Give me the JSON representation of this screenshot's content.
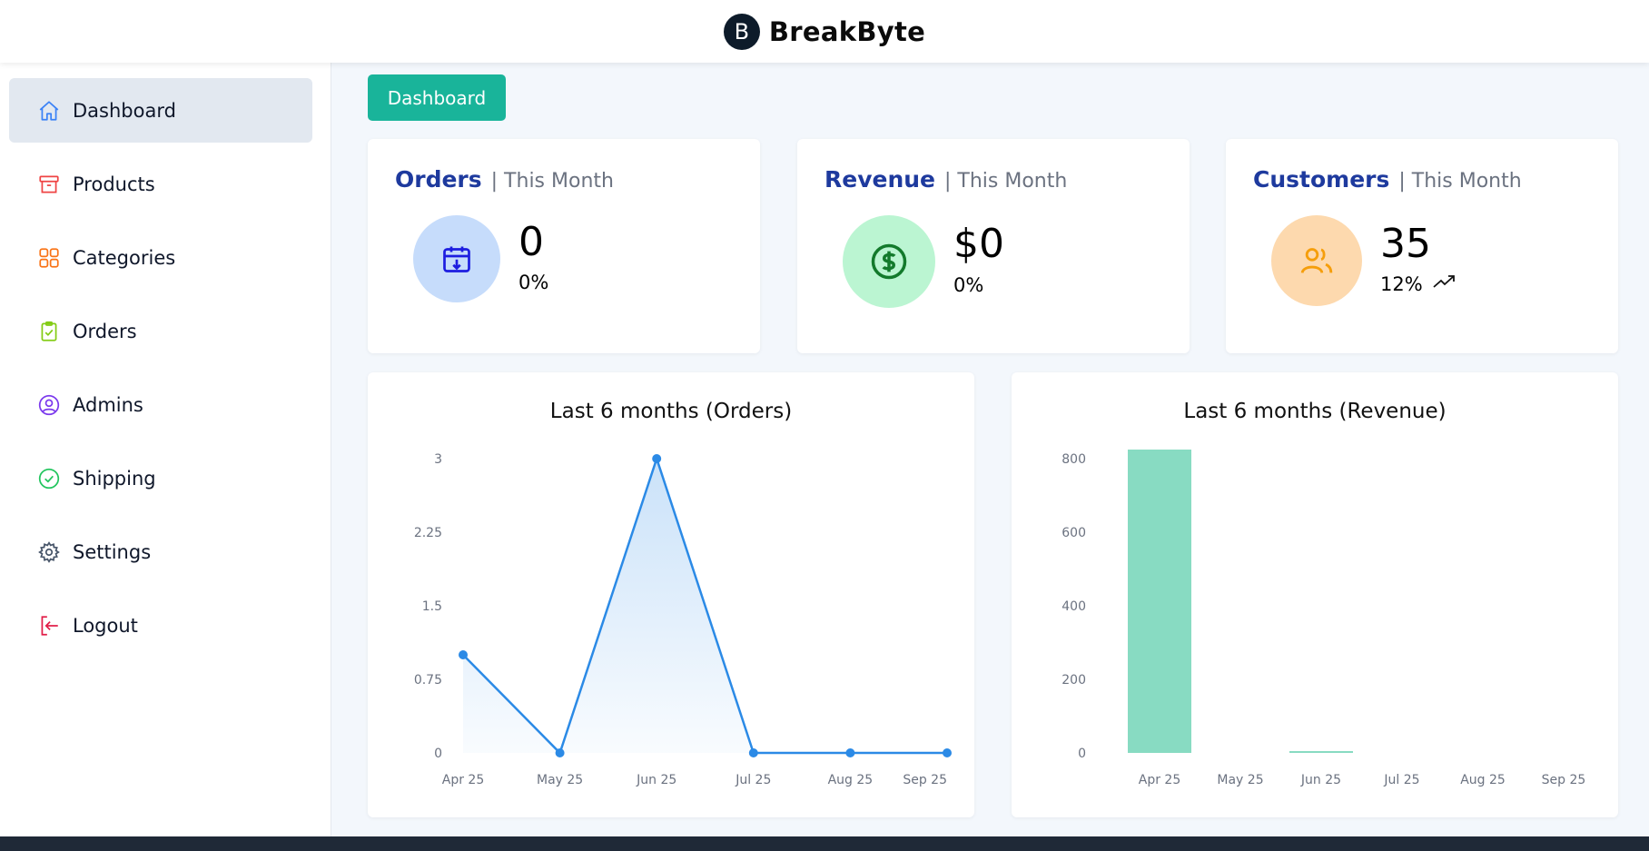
{
  "brand": {
    "logo_letter": "B",
    "name": "BreakByte"
  },
  "sidebar": {
    "items": [
      {
        "label": "Dashboard",
        "icon": "home-icon",
        "color": "#3b82f6",
        "active": true
      },
      {
        "label": "Products",
        "icon": "archive-icon",
        "color": "#ef4444"
      },
      {
        "label": "Categories",
        "icon": "grid-icon",
        "color": "#f97316"
      },
      {
        "label": "Orders",
        "icon": "clipboard-check-icon",
        "color": "#84cc16"
      },
      {
        "label": "Admins",
        "icon": "user-circle-icon",
        "color": "#7c3aed"
      },
      {
        "label": "Shipping",
        "icon": "check-circle-icon",
        "color": "#22c55e"
      },
      {
        "label": "Settings",
        "icon": "gear-icon",
        "color": "#475569"
      },
      {
        "label": "Logout",
        "icon": "logout-icon",
        "color": "#e11d48"
      }
    ]
  },
  "breadcrumb": {
    "label": "Dashboard"
  },
  "cards": [
    {
      "title": "Orders",
      "subtitle": "| This Month",
      "value": "0",
      "percent": "0%",
      "icon": "calendar-download-icon",
      "circle_color": "#c6dcfb",
      "icon_color": "#1d1de0"
    },
    {
      "title": "Revenue",
      "subtitle": "| This Month",
      "value": "$0",
      "percent": "0%",
      "icon": "dollar-icon",
      "circle_color": "#bbf5d2",
      "icon_color": "#137a2c"
    },
    {
      "title": "Customers",
      "subtitle": "| This Month",
      "value": "35",
      "percent": "12%",
      "icon": "users-icon",
      "circle_color": "#fdd9ae",
      "icon_color": "#f59e0b",
      "trend": "trending-up-icon"
    }
  ],
  "chart_data": [
    {
      "type": "line",
      "title": "Last 6 months (Orders)",
      "categories": [
        "Apr 25",
        "May 25",
        "Jun 25",
        "Jul 25",
        "Aug 25",
        "Sep 25"
      ],
      "values": [
        1,
        0,
        3,
        0,
        0,
        0
      ],
      "yticks": [
        "0",
        "0.75",
        "1.5",
        "2.25",
        "3"
      ],
      "ylim": [
        0,
        3
      ],
      "color": "#2b8ae6",
      "fill": "area gradient"
    },
    {
      "type": "bar",
      "title": "Last 6 months (Revenue)",
      "categories": [
        "Apr 25",
        "May 25",
        "Jun 25",
        "Jul 25",
        "Aug 25",
        "Sep 25"
      ],
      "values": [
        800,
        0,
        4,
        0,
        0,
        0
      ],
      "yticks": [
        "0",
        "200",
        "400",
        "600",
        "800"
      ],
      "ylim": [
        0,
        800
      ],
      "color": "#88dbc2"
    }
  ]
}
